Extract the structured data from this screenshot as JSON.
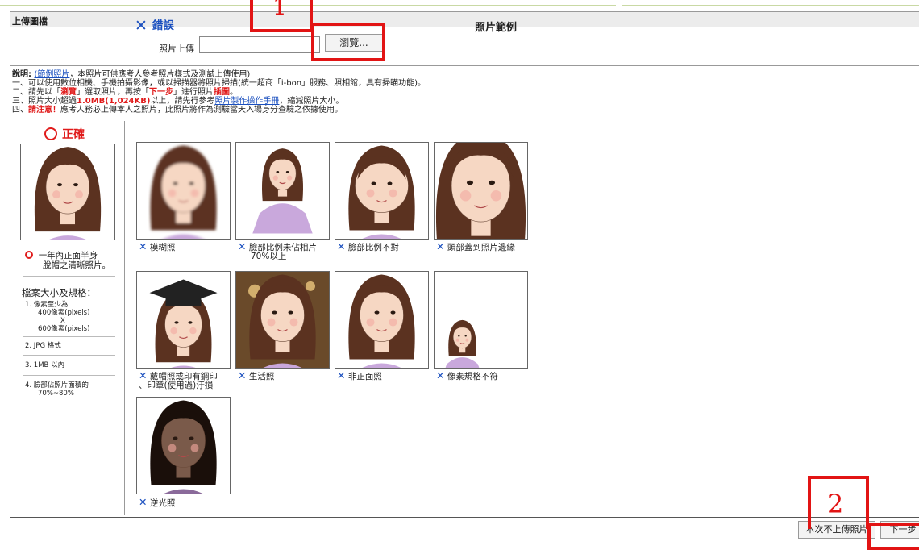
{
  "section_title": "上傳圖檔",
  "upload": {
    "label": "照片上傳",
    "browse_label": "瀏覽..."
  },
  "description": {
    "line0_prefix": "說明: ",
    "line0_link": "(範例照片",
    "line0_suffix": "，本照片可供應考人參考照片樣式及測試上傳使用)",
    "line1": "一、可以使用數位相機、手機拍攝影像，或以掃描器將照片掃描(統一超商「i-bon」服務、照相館，具有掃瞄功能)。",
    "line2_a": "二、請先以「",
    "line2_b": "瀏覽",
    "line2_c": "」選取照片，再按「",
    "line2_d": "下一步",
    "line2_e": "」進行照片",
    "line2_f": "插圖",
    "line2_g": "。",
    "line3_a": "三、照片大小超過",
    "line3_b": "1.0MB(1,024KB)",
    "line3_c": "以上，請先行參考",
    "line3_link": "照片製作操作手冊",
    "line3_d": "，縮減照片大小。",
    "line4_a": "四、",
    "line4_b": "請注意！",
    "line4_c": "應考人務必上傳本人之照片，此照片將作為測驗當天入場身分查驗之依據使用。"
  },
  "correct": {
    "heading": "正確",
    "caption_1": "一年內正面半身",
    "caption_2": "脫帽之清晰照片。",
    "spec_title": "檔案大小及規格：",
    "spec1_a": "1.  像素至少為",
    "spec1_b": "400像素(pixels)",
    "spec1_c": "X",
    "spec1_d": "600像素(pixels)",
    "spec2": "2.  JPG 格式",
    "spec3": "3.  1MB 以內",
    "spec4_a": "4.  臉部佔照片面積的",
    "spec4_b": "70%~80%"
  },
  "wrong": {
    "heading": "錯誤",
    "x_glyph": "✕",
    "examples_title": "照片範例",
    "items": [
      {
        "label": "模糊照"
      },
      {
        "label": "臉部比例未佔相片",
        "label2": "70%以上"
      },
      {
        "label": "臉部比例不對"
      },
      {
        "label": "頭部蓋到照片邊緣"
      },
      {
        "label": "戴帽照或印有鋼印",
        "label2": "、印章(使用過)汙損"
      },
      {
        "label": "生活照"
      },
      {
        "label": "非正面照"
      },
      {
        "label": "像素規格不符"
      },
      {
        "label": "逆光照"
      }
    ]
  },
  "footer": {
    "skip_label": "本次不上傳照片",
    "next_label": "下一步"
  },
  "annotations": {
    "step1": "1",
    "step2": "2"
  },
  "colors": {
    "accent_red": "#e01b1b",
    "x_blue": "#1a4fbf",
    "annotation_red": "#e21414",
    "skin": "#f6d7c3",
    "hair": "#5b3220",
    "shirt": "#c9a8dc"
  }
}
